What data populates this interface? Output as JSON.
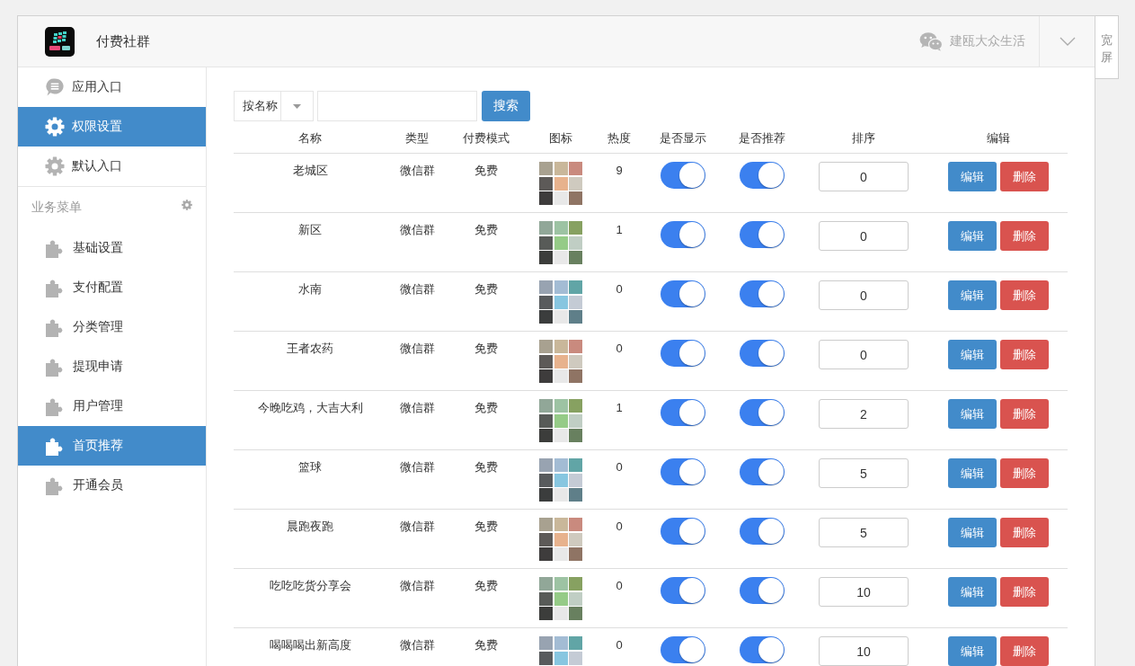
{
  "header": {
    "app_title": "付费社群",
    "account_name": "建瓯大众生活",
    "side_tab": "宽屏"
  },
  "sidebar": {
    "items": [
      {
        "label": "应用入口",
        "kind": "chat",
        "selected": false
      },
      {
        "label": "权限设置",
        "kind": "gear",
        "selected": true
      },
      {
        "label": "默认入口",
        "kind": "gear",
        "selected": false
      }
    ],
    "section": {
      "title": "业务菜单",
      "items": [
        {
          "label": "基础设置",
          "kind": "puzzle",
          "selected": false
        },
        {
          "label": "支付配置",
          "kind": "puzzle",
          "selected": false
        },
        {
          "label": "分类管理",
          "kind": "puzzle",
          "selected": false
        },
        {
          "label": "提现申请",
          "kind": "puzzle",
          "selected": false
        },
        {
          "label": "用户管理",
          "kind": "puzzle",
          "selected": false
        },
        {
          "label": "首页推荐",
          "kind": "puzzle",
          "selected": true
        },
        {
          "label": "开通会员",
          "kind": "puzzle",
          "selected": false
        }
      ]
    }
  },
  "search": {
    "filter": "按名称",
    "button": "搜索"
  },
  "table": {
    "columns": [
      "名称",
      "类型",
      "付费模式",
      "图标",
      "热度",
      "是否显示",
      "是否推荐",
      "排序",
      "编辑"
    ],
    "rows": [
      {
        "name": "老城区",
        "type": "微信群",
        "pay_mode": "免费",
        "heat": "9",
        "show": true,
        "recommend": true,
        "sort": "0",
        "edit_button": "编辑",
        "delete_button": "删除"
      },
      {
        "name": "新区",
        "type": "微信群",
        "pay_mode": "免费",
        "heat": "1",
        "show": true,
        "recommend": true,
        "sort": "0",
        "edit_button": "编辑",
        "delete_button": "删除"
      },
      {
        "name": "水南",
        "type": "微信群",
        "pay_mode": "免费",
        "heat": "0",
        "show": true,
        "recommend": true,
        "sort": "0",
        "edit_button": "编辑",
        "delete_button": "删除"
      },
      {
        "name": "王者农药",
        "type": "微信群",
        "pay_mode": "免费",
        "heat": "0",
        "show": true,
        "recommend": true,
        "sort": "0",
        "edit_button": "编辑",
        "delete_button": "删除"
      },
      {
        "name": "今晚吃鸡，大吉大利",
        "type": "微信群",
        "pay_mode": "免费",
        "heat": "1",
        "show": true,
        "recommend": true,
        "sort": "2",
        "edit_button": "编辑",
        "delete_button": "删除"
      },
      {
        "name": "篮球",
        "type": "微信群",
        "pay_mode": "免费",
        "heat": "0",
        "show": true,
        "recommend": true,
        "sort": "5",
        "edit_button": "编辑",
        "delete_button": "删除"
      },
      {
        "name": "晨跑夜跑",
        "type": "微信群",
        "pay_mode": "免费",
        "heat": "0",
        "show": true,
        "recommend": true,
        "sort": "5",
        "edit_button": "编辑",
        "delete_button": "删除"
      },
      {
        "name": "吃吃吃货分享会",
        "type": "微信群",
        "pay_mode": "免费",
        "heat": "0",
        "show": true,
        "recommend": true,
        "sort": "10",
        "edit_button": "编辑",
        "delete_button": "删除"
      },
      {
        "name": "喝喝喝出新高度",
        "type": "微信群",
        "pay_mode": "免费",
        "heat": "0",
        "show": true,
        "recommend": true,
        "sort": "10",
        "edit_button": "编辑",
        "delete_button": "删除"
      }
    ]
  }
}
